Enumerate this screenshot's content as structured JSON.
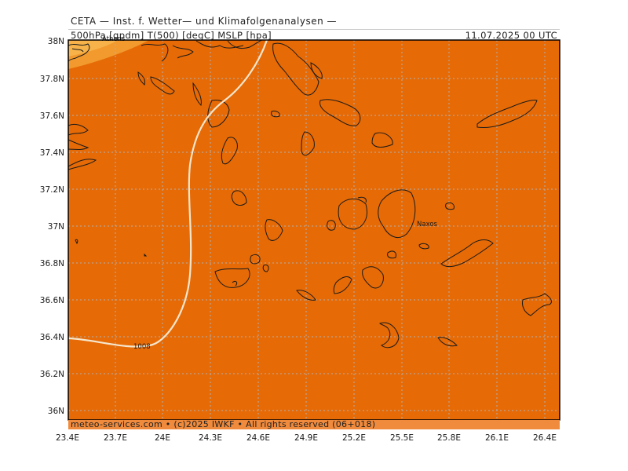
{
  "header": {
    "title": "CETA — Inst. f. Wetter— und Klimafolgenanalysen —",
    "params": "500hPa [gpdm] T(500) [degC] MSLP [hpa]",
    "datetime": "11.07.2025 00 UTC"
  },
  "footer": {
    "credits": "meteo-services.com • (c)2025 IWKF • All rights reserved (06+018)"
  },
  "map": {
    "lon_ticks": [
      "23.4E",
      "23.7E",
      "24E",
      "24.3E",
      "24.6E",
      "24.9E",
      "25.2E",
      "25.5E",
      "25.8E",
      "26.1E",
      "26.4E"
    ],
    "lat_ticks": [
      "38N",
      "37.8N",
      "37.6N",
      "37.4N",
      "37.2N",
      "37N",
      "36.8N",
      "36.6N",
      "36.4N",
      "36.2N",
      "36N"
    ],
    "isobar_label": "1008",
    "place_labels": {
      "athens": "Athens",
      "naxos": "Naxos"
    },
    "colors": {
      "fill": "#e66a06",
      "corner_fill": "#f29a2e",
      "isobar": "#f5e6cc",
      "coast": "#1a1a1a",
      "grid": "#b0b0b0"
    }
  }
}
